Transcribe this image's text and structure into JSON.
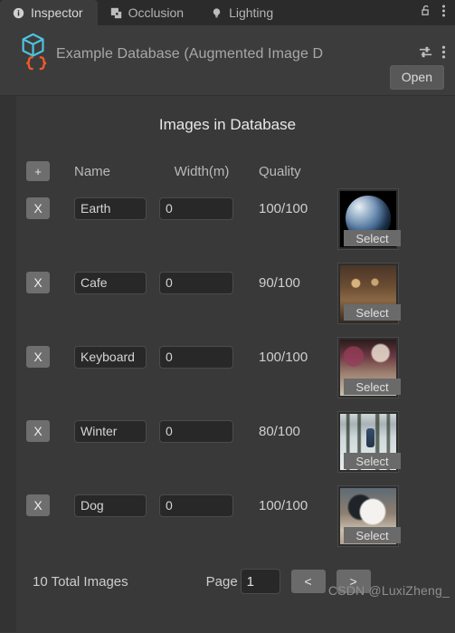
{
  "tabbar": {
    "tabs": [
      {
        "label": "Inspector",
        "icon": "info-icon",
        "active": true
      },
      {
        "label": "Occlusion",
        "icon": "occlusion-icon",
        "active": false
      },
      {
        "label": "Lighting",
        "icon": "lightbulb-icon",
        "active": false
      }
    ],
    "lock_icon": "unlocked-padlock-icon",
    "menu_icon": "kebab-menu-icon"
  },
  "header": {
    "asset_icon": "scriptable-object-icon",
    "title": "Example Database (Augmented Image D",
    "preset_icon": "preset-settings-icon",
    "menu_icon": "kebab-menu-icon",
    "open_label": "Open"
  },
  "main": {
    "section_title": "Images in Database",
    "add_label": "+",
    "columns": {
      "name": "Name",
      "width": "Width(m)",
      "quality": "Quality"
    },
    "select_label": "Select",
    "delete_label": "X",
    "rows": [
      {
        "name": "Earth",
        "width": "0",
        "quality": "100/100",
        "art": "art-earth"
      },
      {
        "name": "Cafe",
        "width": "0",
        "quality": "90/100",
        "art": "art-cafe"
      },
      {
        "name": "Keyboard",
        "width": "0",
        "quality": "100/100",
        "art": "art-keyboard"
      },
      {
        "name": "Winter",
        "width": "0",
        "quality": "80/100",
        "art": "art-winter"
      },
      {
        "name": "Dog",
        "width": "0",
        "quality": "100/100",
        "art": "art-dog"
      }
    ]
  },
  "footer": {
    "total_text": "10 Total Images",
    "page_label": "Page",
    "page_value": "1",
    "prev_label": "<",
    "next_label": ">"
  },
  "watermark": "CSDN @LuxiZheng_",
  "colors": {
    "window_bg": "#393939",
    "tabbar_bg": "#2b2b2b",
    "header_bg": "#3c3c3c",
    "field_bg": "#282828",
    "button_bg": "#6a6a6a",
    "asset_icon_cyan": "#4ec3e0",
    "asset_icon_orange": "#f05a28"
  }
}
